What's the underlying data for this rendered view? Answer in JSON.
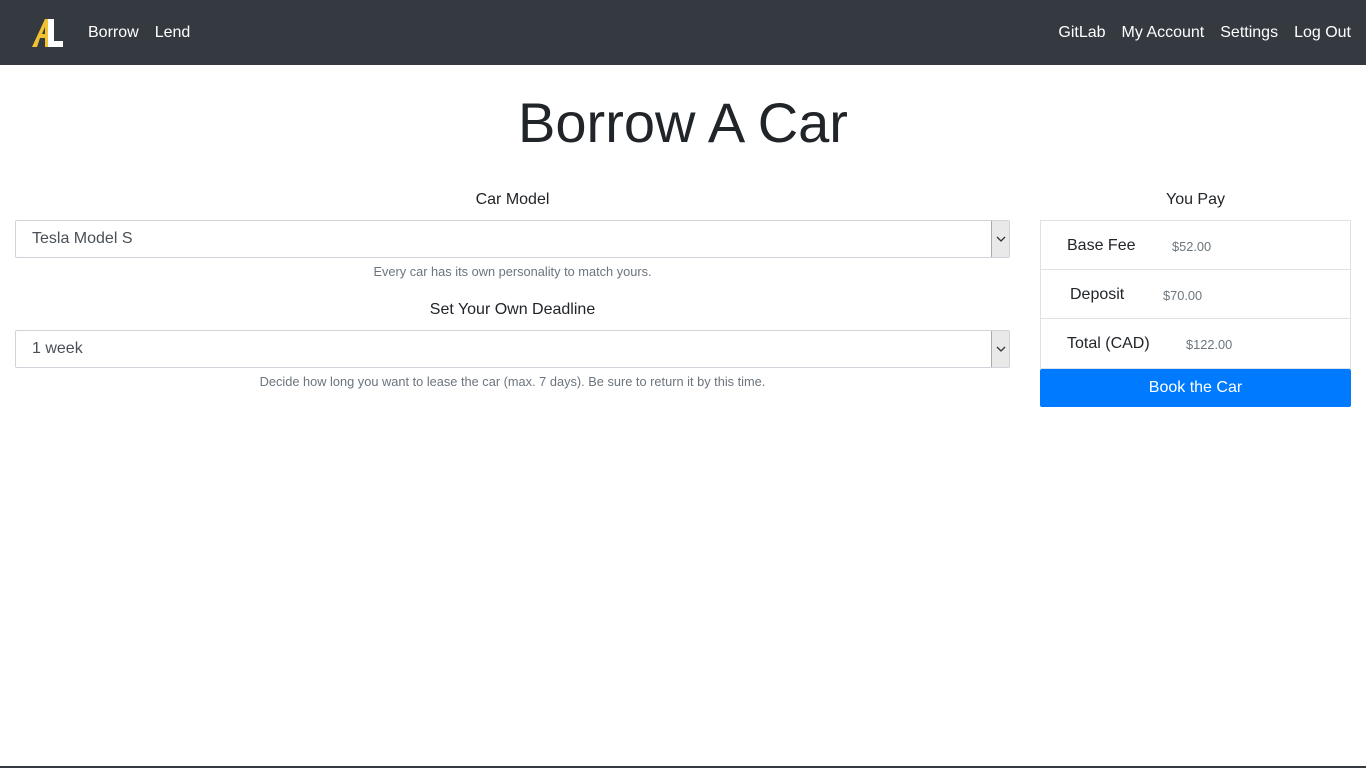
{
  "nav": {
    "left": [
      "Borrow",
      "Lend"
    ],
    "right": [
      "GitLab",
      "My Account",
      "Settings",
      "Log Out"
    ],
    "brand_icon": "al-logo",
    "brand_colors": {
      "a": "#f1c232",
      "l": "#ffffff"
    }
  },
  "page": {
    "title": "Borrow A Car"
  },
  "form": {
    "car_model": {
      "label": "Car Model",
      "value": "Tesla Model S",
      "help": "Every car has its own personality to match yours."
    },
    "deadline": {
      "label": "Set Your Own Deadline",
      "value": "1 week",
      "help": "Decide how long you want to lease the car (max. 7 days). Be sure to return it by this time."
    }
  },
  "pay": {
    "title": "You Pay",
    "items": [
      {
        "label": "Base Fee",
        "value": "$52.00"
      },
      {
        "label": "Deposit",
        "value": "$70.00"
      },
      {
        "label": "Total (CAD)",
        "value": "$122.00"
      }
    ],
    "book_label": "Book the Car"
  },
  "colors": {
    "navbar": "#343a40",
    "primary": "#007bff"
  }
}
